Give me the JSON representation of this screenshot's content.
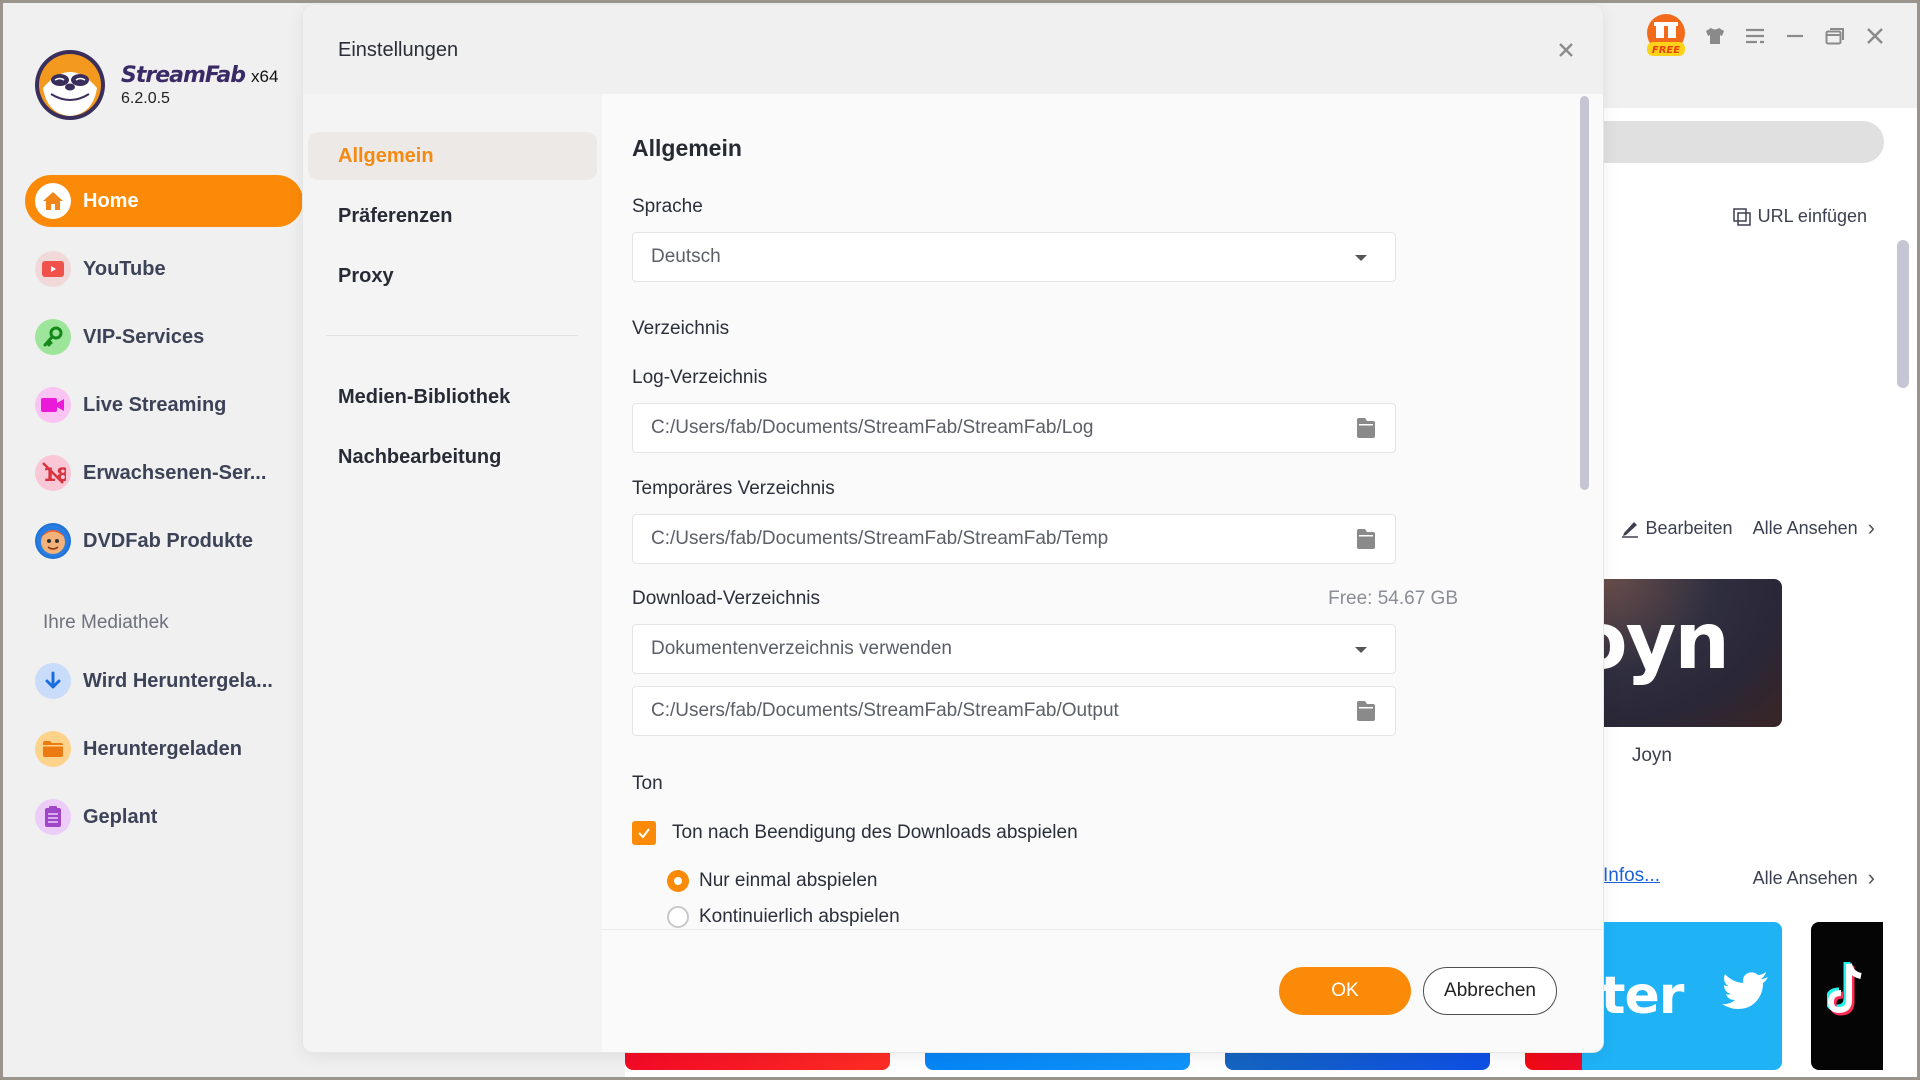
{
  "app": {
    "name": "StreamFab",
    "arch": "x64",
    "version": "6.2.0.5"
  },
  "sidebar": {
    "items": [
      {
        "label": "Home",
        "icon": "home-icon",
        "active": true
      },
      {
        "label": "YouTube",
        "icon": "youtube-icon"
      },
      {
        "label": "VIP-Services",
        "icon": "key-icon"
      },
      {
        "label": "Live Streaming",
        "icon": "video-camera-icon"
      },
      {
        "label": "Erwachsenen-Ser...",
        "icon": "no-18-icon"
      },
      {
        "label": "DVDFab Produkte",
        "icon": "dvdfab-mascot-icon"
      }
    ],
    "library_title": "Ihre Mediathek",
    "library_items": [
      {
        "label": "Wird Heruntergela...",
        "icon": "download-arrow-icon"
      },
      {
        "label": "Heruntergeladen",
        "icon": "folder-icon"
      },
      {
        "label": "Geplant",
        "icon": "schedule-list-icon"
      }
    ]
  },
  "topbar": {
    "free_badge": "FREE",
    "icons": [
      "gift-free-icon",
      "tshirt-skin-icon",
      "menu-icon",
      "minimize-icon",
      "restore-icon",
      "close-icon"
    ]
  },
  "background": {
    "url_insert": "URL einfügen",
    "edit": "Bearbeiten",
    "view_all": "Alle Ansehen",
    "joyn_card_text": "oyn",
    "joyn_label": "Joyn",
    "infos_link": "Infos...",
    "view_all_2": "Alle Ansehen",
    "twitter_card_text": "itter"
  },
  "dialog": {
    "title": "Einstellungen",
    "nav": [
      {
        "label": "Allgemein",
        "active": true
      },
      {
        "label": "Präferenzen"
      },
      {
        "label": "Proxy"
      },
      {
        "label": "Medien-Bibliothek"
      },
      {
        "label": "Nachbearbeitung"
      }
    ],
    "section_title": "Allgemein",
    "language": {
      "label": "Sprache",
      "value": "Deutsch"
    },
    "directory_title": "Verzeichnis",
    "log_dir": {
      "label": "Log-Verzeichnis",
      "value": "C:/Users/fab/Documents/StreamFab/StreamFab/Log"
    },
    "temp_dir": {
      "label": "Temporäres Verzeichnis",
      "value": "C:/Users/fab/Documents/StreamFab/StreamFab/Temp"
    },
    "download_dir": {
      "label": "Download-Verzeichnis",
      "free_space": "Free: 54.67 GB",
      "mode": "Dokumentenverzeichnis verwenden",
      "value": "C:/Users/fab/Documents/StreamFab/StreamFab/Output"
    },
    "sound": {
      "title": "Ton",
      "checkbox_label": "Ton nach Beendigung des Downloads abspielen",
      "checked": true,
      "options": [
        {
          "label": "Nur einmal abspielen",
          "selected": true
        },
        {
          "label": "Kontinuierlich abspielen",
          "selected": false
        }
      ]
    },
    "buttons": {
      "ok": "OK",
      "cancel": "Abbrechen"
    }
  },
  "colors": {
    "accent": "#fb8a08",
    "active_nav_text": "#f28a13",
    "link": "#1d63d8"
  }
}
